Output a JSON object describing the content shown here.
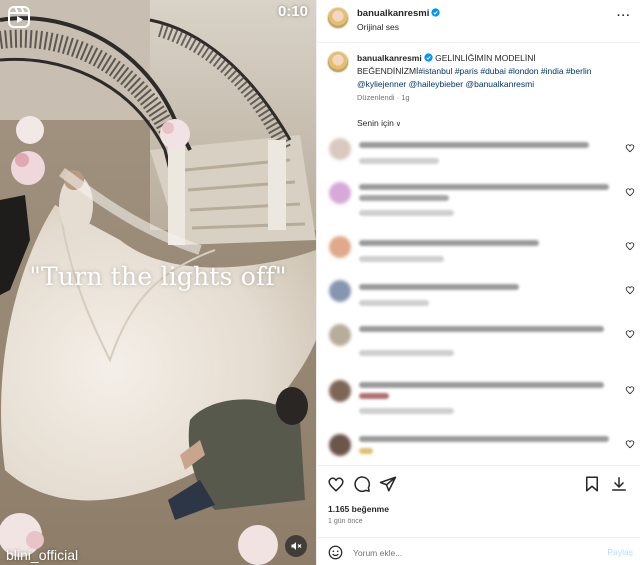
{
  "media": {
    "timer": "0:10",
    "overlay_caption": "\"Turn the lights off\"",
    "watermark": "blini_official"
  },
  "header": {
    "username": "banualkanresmi",
    "subtitle": "Orijinal ses"
  },
  "caption": {
    "username": "banualkanresmi",
    "text": "GELİNLİĞİMİN MODELİNİ BEĞENDİNİZMİ",
    "hashtags": [
      "#istanbul",
      "#paris",
      "#dubai",
      "#london",
      "#india",
      "#berlin"
    ],
    "mentions": [
      "@kyliejenner",
      "@haileybieber",
      "@banualkanresmi"
    ],
    "meta": "Düzenlendi · 1g"
  },
  "comments": {
    "sort_label": "Senin için"
  },
  "footer": {
    "likes": "1.165 beğenme",
    "time_ago": "1 gün önce",
    "comment_placeholder": "Yorum ekle...",
    "post_label": "Paylaş"
  },
  "colors": {
    "verified": "#0095f6",
    "link": "#00376b",
    "muted_text": "#737373",
    "post_disabled": "#b2dffc"
  }
}
